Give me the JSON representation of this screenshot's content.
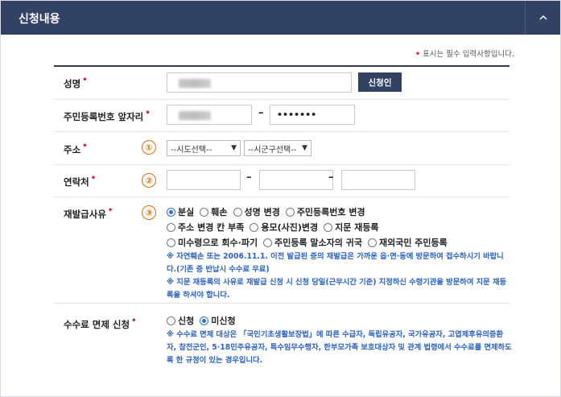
{
  "header": {
    "title": "신청내용"
  },
  "required_note": "표시는 필수 입력사항입니다.",
  "required_dot": "•",
  "form": {
    "name": {
      "label": "성명",
      "button": "신청인"
    },
    "rrn": {
      "label": "주민등록번호 앞자리",
      "back_value": "•••••••",
      "dash": "–"
    },
    "address": {
      "label": "주소",
      "marker": "①",
      "sido": "--시도선택--",
      "sigungu": "--시군구선택--"
    },
    "contact": {
      "label": "연락처",
      "marker": "②",
      "dash": "–"
    },
    "reason": {
      "label": "재발급사유",
      "marker": "③",
      "options_line1": [
        "분실",
        "훼손",
        "성명 변경",
        "주민등록번호 변경"
      ],
      "options_line2": [
        "주소 변경 칸 부족",
        "용모(사진)변경",
        "지문 재등록"
      ],
      "options_line3": [
        "미수령으로 회수·파기",
        "주민등록 말소자의 귀국",
        "재외국민 주민등록"
      ],
      "selected": "분실",
      "note1": "※ 자연훼손 또는 2006.11.1. 이전 발급된 증의 재발급은 가까운 읍·면·동에 방문하여 접수하시기 바랍니다.(기존 증 반납시 수수료 무료)",
      "note2": "※ 지문 재등록의 사유로 재발급 신청 시 신청 당일(근무시간 기준) 지정하신 수령기관을 방문하여 지문 재등록을 하셔야 합니다."
    },
    "fee": {
      "label": "수수료 면제 신청",
      "options": [
        "신청",
        "미신청"
      ],
      "selected": "미신청",
      "note": "※ 수수료 면제 대상은 「국민기초생활보장법」에 따른 수급자, 독립유공자, 국가유공자, 고엽제후유의증환자, 참전군인, 5·18민주유공자, 특수임무수행자, 한부모가족 보호대상자 및 관계 법령에서 수수료를 면제하도록 한 규정이 있는 경우입니다."
    }
  },
  "colors": {
    "header": "#324265",
    "accent": "#2a62c7",
    "required": "#e0193c",
    "marker": "#e26b00"
  }
}
